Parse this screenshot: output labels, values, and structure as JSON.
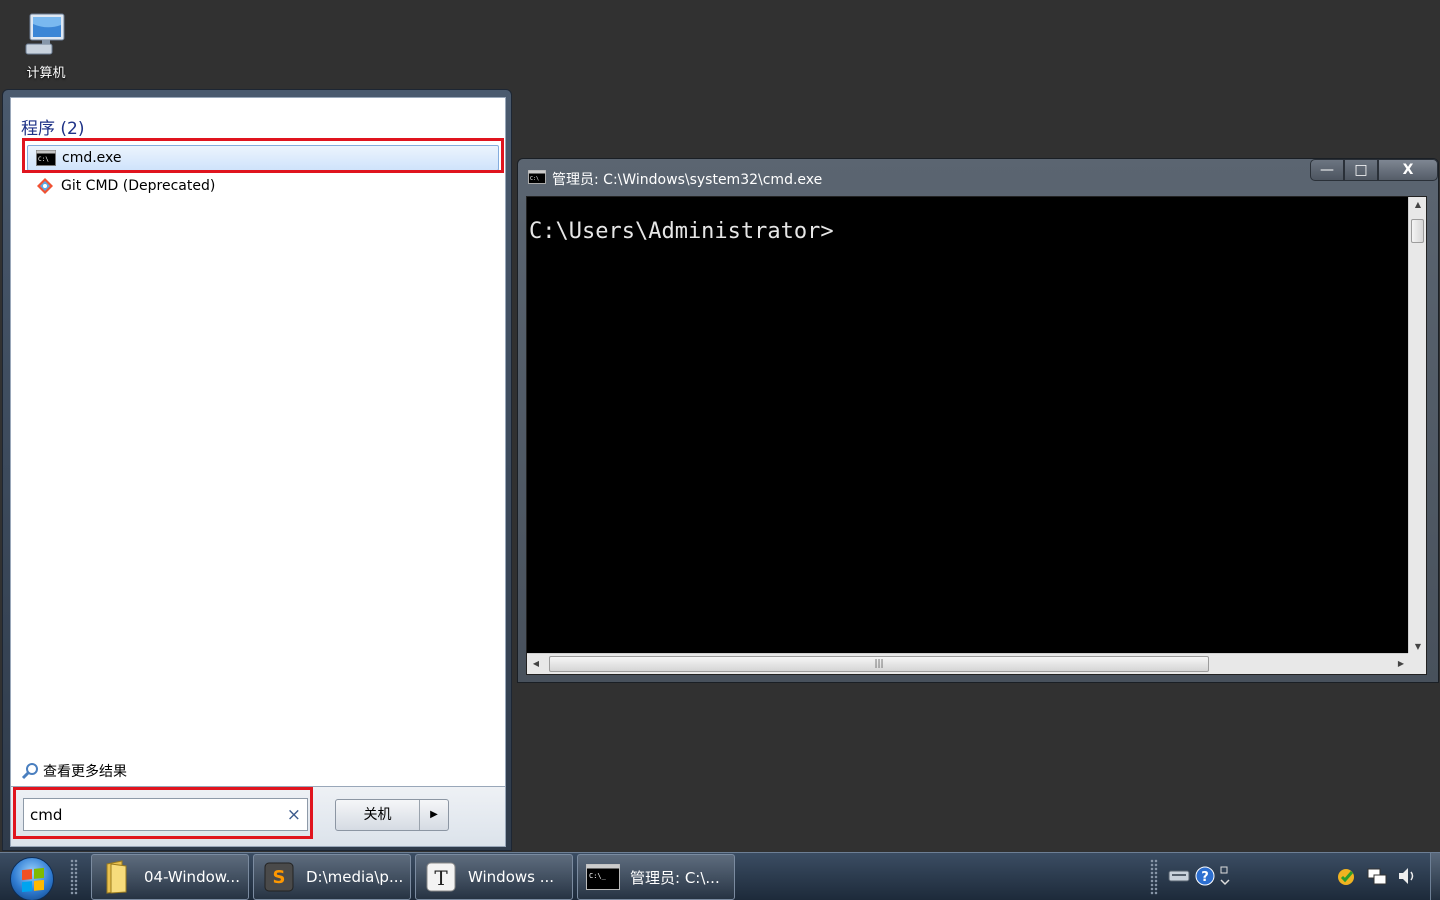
{
  "desktop": {
    "computer_label": "计算机"
  },
  "start_menu": {
    "section_header": "程序 (2)",
    "results": [
      {
        "label": "cmd.exe",
        "icon": "cmd-icon",
        "selected": true
      },
      {
        "label": "Git CMD (Deprecated)",
        "icon": "git-icon",
        "selected": false
      }
    ],
    "more_results": "查看更多结果",
    "search_value": "cmd",
    "clear_symbol": "×",
    "shutdown_label": "关机",
    "shutdown_arrow": "▶"
  },
  "cmd_window": {
    "title": "管理员: C:\\Windows\\system32\\cmd.exe",
    "prompt": "C:\\Users\\Administrator>",
    "btn_min": "—",
    "btn_max": "□",
    "btn_close": "X"
  },
  "taskbar": {
    "items": [
      {
        "label": "04-Window...",
        "icon": "folder-icon"
      },
      {
        "label": "D:\\media\\p...",
        "icon": "sublime-icon"
      },
      {
        "label": "Windows ...",
        "icon": "typora-icon"
      },
      {
        "label": "管理员: C:\\...",
        "icon": "cmd-icon"
      }
    ]
  },
  "colors": {
    "accent_red": "#e0141e",
    "section_blue": "#1e3287",
    "desktop_bg": "#313131"
  }
}
